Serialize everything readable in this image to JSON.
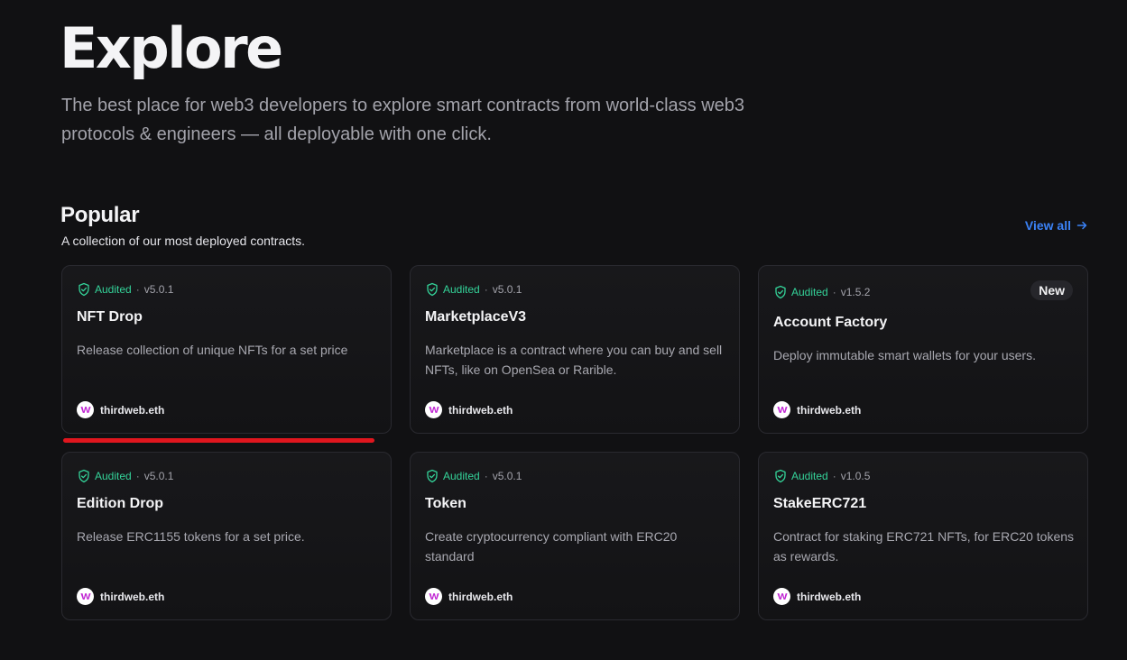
{
  "hero": {
    "title": "Explore",
    "subtitle": "The best place for web3 developers to explore smart contracts from world-class web3 protocols & engineers — all deployable with one click."
  },
  "popular": {
    "title": "Popular",
    "subtitle": "A collection of our most deployed contracts.",
    "view_all": "View all"
  },
  "cards": [
    {
      "audited": "Audited",
      "sep": "·",
      "version": "v5.0.1",
      "title": "NFT Drop",
      "description": "Release collection of unique NFTs for a set price",
      "author": "thirdweb.eth"
    },
    {
      "audited": "Audited",
      "sep": "·",
      "version": "v5.0.1",
      "title": "MarketplaceV3",
      "description": "Marketplace is a contract where you can buy and sell NFTs, like on OpenSea or Rarible.",
      "author": "thirdweb.eth"
    },
    {
      "audited": "Audited",
      "sep": "·",
      "version": "v1.5.2",
      "title": "Account Factory",
      "description": "Deploy immutable smart wallets for your users.",
      "author": "thirdweb.eth",
      "badge": "New"
    },
    {
      "audited": "Audited",
      "sep": "·",
      "version": "v5.0.1",
      "title": "Edition Drop",
      "description": "Release ERC1155 tokens for a set price.",
      "author": "thirdweb.eth"
    },
    {
      "audited": "Audited",
      "sep": "·",
      "version": "v5.0.1",
      "title": "Token",
      "description": "Create cryptocurrency compliant with ERC20 standard",
      "author": "thirdweb.eth"
    },
    {
      "audited": "Audited",
      "sep": "·",
      "version": "v1.0.5",
      "title": "StakeERC721",
      "description": "Contract for staking ERC721 NFTs, for ERC20 tokens as rewards.",
      "author": "thirdweb.eth"
    }
  ],
  "icons": {
    "shield": "shield-check-icon",
    "arrow": "arrow-right-icon",
    "avatar": "thirdweb-logo-icon"
  },
  "colors": {
    "background": "#111113",
    "audited_green": "#34d399",
    "link_blue": "#3b82f6",
    "annotation_red": "#e0161e"
  }
}
